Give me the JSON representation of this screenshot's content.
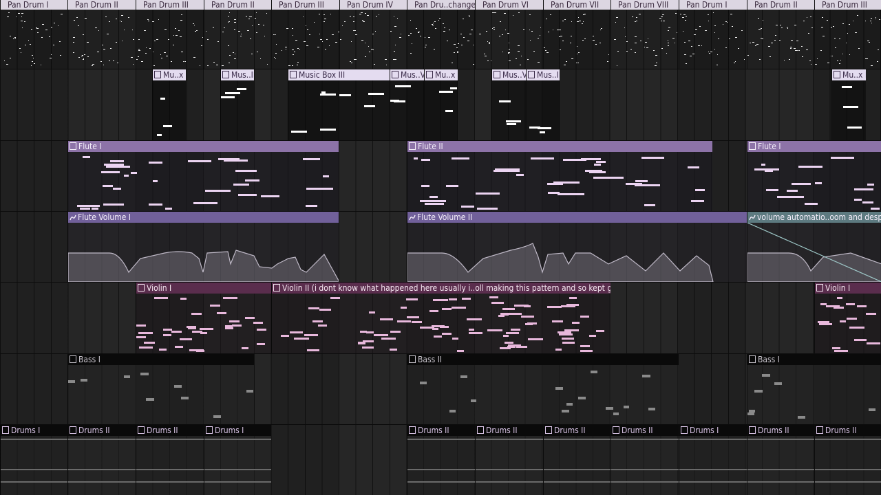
{
  "colors": {
    "pan_drum_header": "#dcd6e2",
    "music_box_header": "#e4dcf0",
    "flute_header": "#8d73a8",
    "volume_header": "#71609a",
    "volume_teal_header": "#5d7a80",
    "violin_header": "#5a2d4d",
    "bass_header": "#0a0a0a",
    "drums_header": "#0a0a0a",
    "note_light": "#ffffff",
    "note_flute": "#ecd4f2",
    "note_violin": "#e8b8dc",
    "note_bass": "#8a8a8a"
  },
  "icons": {
    "pattern": "pattern-icon",
    "automation": "automation-curve-icon"
  },
  "tracks": {
    "pan_drum": {
      "clips": [
        {
          "label": "Pan Drum I"
        },
        {
          "label": "Pan Drum II"
        },
        {
          "label": "Pan Drum III"
        },
        {
          "label": "Pan Drum II"
        },
        {
          "label": "Pan Drum III"
        },
        {
          "label": "Pan Drum IV"
        },
        {
          "label": "Pan Dru..change)"
        },
        {
          "label": "Pan Drum VI"
        },
        {
          "label": "Pan Drum VII"
        },
        {
          "label": "Pan Drum VIII"
        },
        {
          "label": "Pan Drum I"
        },
        {
          "label": "Pan Drum II"
        },
        {
          "label": "Pan Drum III"
        }
      ]
    },
    "music_box": {
      "clips": [
        {
          "label": "Mu..x I"
        },
        {
          "label": "Mus..II"
        },
        {
          "label": "Music Box III"
        },
        {
          "label": "Mus..V"
        },
        {
          "label": "Mu..x V"
        },
        {
          "label": "Mus..VI"
        },
        {
          "label": "Mus..II"
        },
        {
          "label": "Mu..x I"
        }
      ]
    },
    "flute": {
      "clips": [
        {
          "label": "Flute I"
        },
        {
          "label": "Flute II"
        },
        {
          "label": "Flute I"
        }
      ]
    },
    "flute_volume": {
      "clips": [
        {
          "label": "Flute Volume I"
        },
        {
          "label": "Flute Volume II"
        },
        {
          "label": "volume automatio..oom and despair"
        }
      ]
    },
    "violin": {
      "clips": [
        {
          "label": "Violin I"
        },
        {
          "label": "Violin II (i dont know what happened here usually i..oll making this pattern and so kept going :ca:)"
        },
        {
          "label": "Violin I"
        }
      ]
    },
    "bass": {
      "clips": [
        {
          "label": "Bass I"
        },
        {
          "label": "Bass II"
        },
        {
          "label": "Bass I"
        }
      ]
    },
    "drums": {
      "clips": [
        {
          "label": "Drums I"
        },
        {
          "label": "Drums II"
        },
        {
          "label": "Drums II"
        },
        {
          "label": "Drums I"
        },
        {
          "label": "Drums II"
        },
        {
          "label": "Drums II"
        },
        {
          "label": "Drums II"
        },
        {
          "label": "Drums II"
        },
        {
          "label": "Drums I"
        },
        {
          "label": "Drums II"
        },
        {
          "label": "Drums II"
        }
      ]
    }
  }
}
